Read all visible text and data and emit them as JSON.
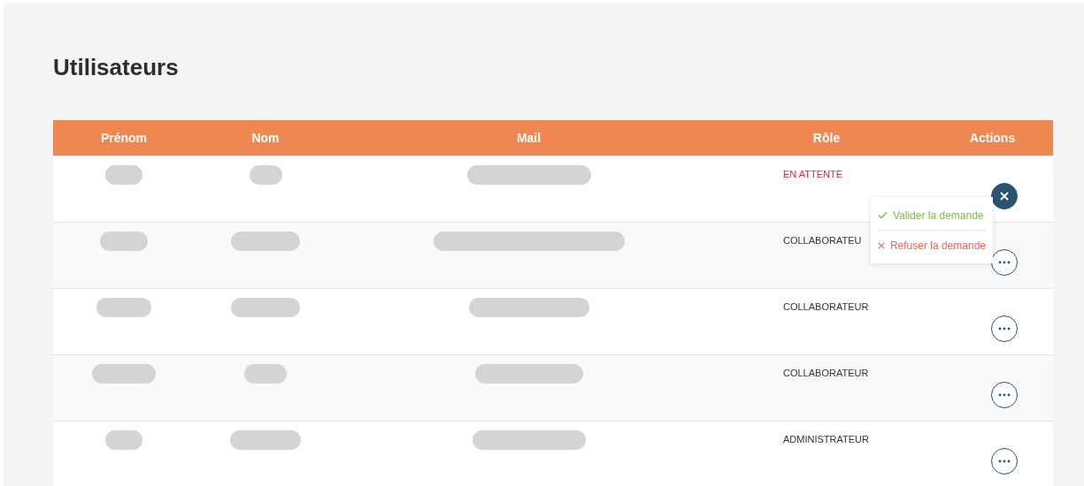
{
  "title": "Utilisateurs",
  "columns": [
    "Prénom",
    "Nom",
    "Mail",
    "Rôle",
    "Actions"
  ],
  "rows": [
    {
      "role": "EN ATTENTE",
      "pending": true,
      "menu_open": true
    },
    {
      "role": "COLLABORATEU",
      "pending": false,
      "menu_open": false
    },
    {
      "role": "COLLABORATEUR",
      "pending": false,
      "menu_open": false
    },
    {
      "role": "COLLABORATEUR",
      "pending": false,
      "menu_open": false
    },
    {
      "role": "ADMINISTRATEUR",
      "pending": false,
      "menu_open": false
    }
  ],
  "menu": [
    {
      "kind": "accept",
      "label": "Valider la demande"
    },
    {
      "kind": "reject",
      "label": "Refuser la demande"
    }
  ]
}
